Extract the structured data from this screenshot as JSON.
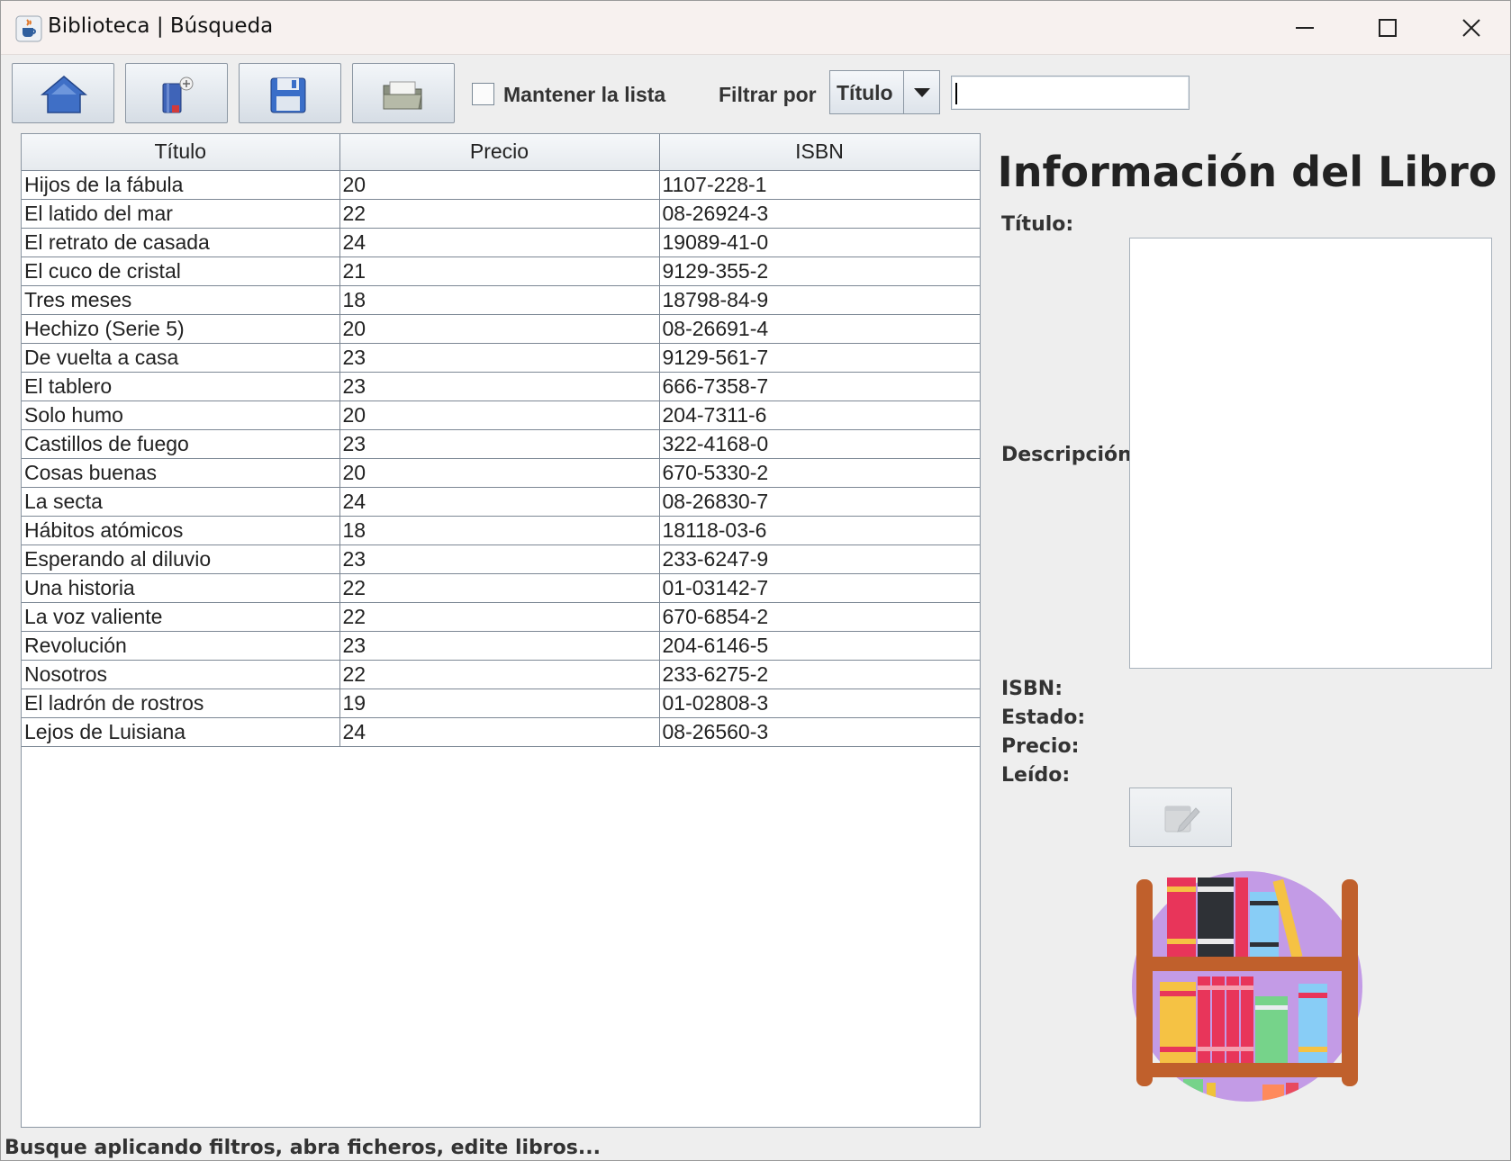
{
  "window": {
    "title": "Biblioteca | Búsqueda",
    "app_icon": "java-cup-icon"
  },
  "toolbar": {
    "buttons": [
      {
        "name": "home",
        "icon": "home-icon"
      },
      {
        "name": "new-book",
        "icon": "book-add-icon"
      },
      {
        "name": "save",
        "icon": "floppy-disk-icon"
      },
      {
        "name": "open",
        "icon": "folder-open-icon"
      }
    ],
    "keep_list_label": "Mantener la lista",
    "keep_list_checked": false,
    "filter_label": "Filtrar por",
    "filter_selected": "Título",
    "filter_value": ""
  },
  "table": {
    "columns": [
      "Título",
      "Precio",
      "ISBN"
    ],
    "rows": [
      [
        "Hijos de la fábula",
        "20",
        "1107-228-1"
      ],
      [
        "El latido del mar",
        "22",
        "08-26924-3"
      ],
      [
        "El retrato de casada",
        "24",
        "19089-41-0"
      ],
      [
        "El cuco de cristal",
        "21",
        "9129-355-2"
      ],
      [
        "Tres meses",
        "18",
        "18798-84-9"
      ],
      [
        "Hechizo (Serie 5)",
        "20",
        "08-26691-4"
      ],
      [
        "De vuelta a casa",
        "23",
        "9129-561-7"
      ],
      [
        "El tablero",
        "23",
        "666-7358-7"
      ],
      [
        "Solo humo",
        "20",
        "204-7311-6"
      ],
      [
        "Castillos de fuego",
        "23",
        "322-4168-0"
      ],
      [
        "Cosas buenas",
        "20",
        "670-5330-2"
      ],
      [
        "La secta",
        "24",
        "08-26830-7"
      ],
      [
        "Hábitos atómicos",
        "18",
        "18118-03-6"
      ],
      [
        "Esperando al diluvio",
        "23",
        "233-6247-9"
      ],
      [
        "Una historia",
        "22",
        "01-03142-7"
      ],
      [
        "La voz valiente",
        "22",
        "670-6854-2"
      ],
      [
        "Revolución",
        "23",
        "204-6146-5"
      ],
      [
        "Nosotros",
        "22",
        "233-6275-2"
      ],
      [
        "El ladrón de rostros",
        "19",
        "01-02808-3"
      ],
      [
        "Lejos de Luisiana",
        "24",
        "08-26560-3"
      ]
    ]
  },
  "info": {
    "heading": "Información del Libro",
    "titulo_label": "Título:",
    "descripcion_label": "Descripción:",
    "isbn_label": "ISBN:",
    "estado_label": "Estado:",
    "precio_label": "Precio:",
    "leido_label": "Leído:",
    "edit_icon": "edit-note-icon",
    "image_icon": "bookshelf-icon"
  },
  "status": "Busque aplicando filtros, abra ficheros, edite libros...",
  "colors": {
    "home": "#3f6fc6",
    "shelf_circle": "#c39be6",
    "shelf_wood": "#c0602c"
  }
}
